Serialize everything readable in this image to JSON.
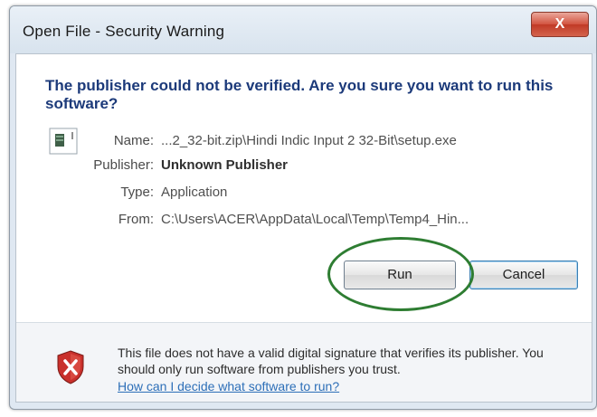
{
  "window": {
    "title": "Open File - Security Warning",
    "close_label": "X"
  },
  "dialog": {
    "question": "The publisher could not be verified.  Are you sure you want to run this software?",
    "fields": {
      "name_label": "Name:",
      "name_value": "...2_32-bit.zip\\Hindi Indic Input 2 32-Bit\\setup.exe",
      "publisher_label": "Publisher:",
      "publisher_value": "Unknown Publisher",
      "type_label": "Type:",
      "type_value": "Application",
      "from_label": "From:",
      "from_value": "C:\\Users\\ACER\\AppData\\Local\\Temp\\Temp4_Hin..."
    }
  },
  "buttons": {
    "run": "Run",
    "cancel": "Cancel"
  },
  "footer": {
    "message": "This file does not have a valid digital signature that verifies its publisher.  You should only run software from publishers you trust.",
    "link": "How can I decide what software to run?"
  },
  "colors": {
    "question_text": "#1c3a7a",
    "link": "#2d6fb8",
    "highlight_circle": "#2e7d32",
    "close_button": "#c03a26"
  },
  "icons": {
    "file": "application-file-icon",
    "warning": "security-shield-warning-icon"
  }
}
